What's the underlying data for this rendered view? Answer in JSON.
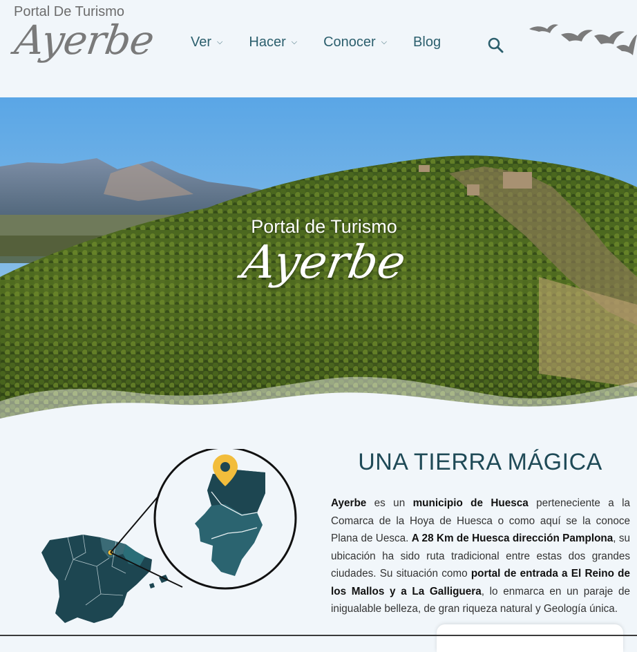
{
  "header": {
    "logo_top": "Portal  De Turismo",
    "logo_script": "Ayerbe",
    "nav": [
      {
        "label": "Ver",
        "has_dropdown": true
      },
      {
        "label": "Hacer",
        "has_dropdown": true
      },
      {
        "label": "Conocer",
        "has_dropdown": true
      },
      {
        "label": "Blog",
        "has_dropdown": false
      }
    ],
    "search_icon": "search-icon",
    "decoration_icon": "birds-icon"
  },
  "hero": {
    "title": "Portal de Turismo",
    "script": "Ayerbe"
  },
  "section": {
    "title": "UNA TIERRA MÁGICA",
    "paragraph": [
      {
        "text": "Ayerbe",
        "bold": true
      },
      {
        "text": " es un ",
        "bold": false
      },
      {
        "text": "municipio de Huesca",
        "bold": true
      },
      {
        "text": " perteneciente a la Comarca de la Hoya de Huesca o como aquí se la conoce Plana de Uesca. ",
        "bold": false
      },
      {
        "text": "A 28 Km de Huesca dirección Pamplona",
        "bold": true
      },
      {
        "text": ", su ubicación ha sido ruta tradicional entre estas dos grandes ciudades. Su situación como ",
        "bold": false
      },
      {
        "text": "portal de entrada a El Reino de los Mallos y a La Galliguera",
        "bold": true
      },
      {
        "text": ", lo enmarca en un paraje de inigualable belleza, de gran riqueza natural y Geología única.",
        "bold": false
      }
    ]
  },
  "colors": {
    "page_bg": "#f1f6fa",
    "nav_text": "#2c5f6d",
    "title": "#1f4a57",
    "map_dark": "#1d4651",
    "map_mid": "#2b6470",
    "pin": "#f2bd3c"
  }
}
